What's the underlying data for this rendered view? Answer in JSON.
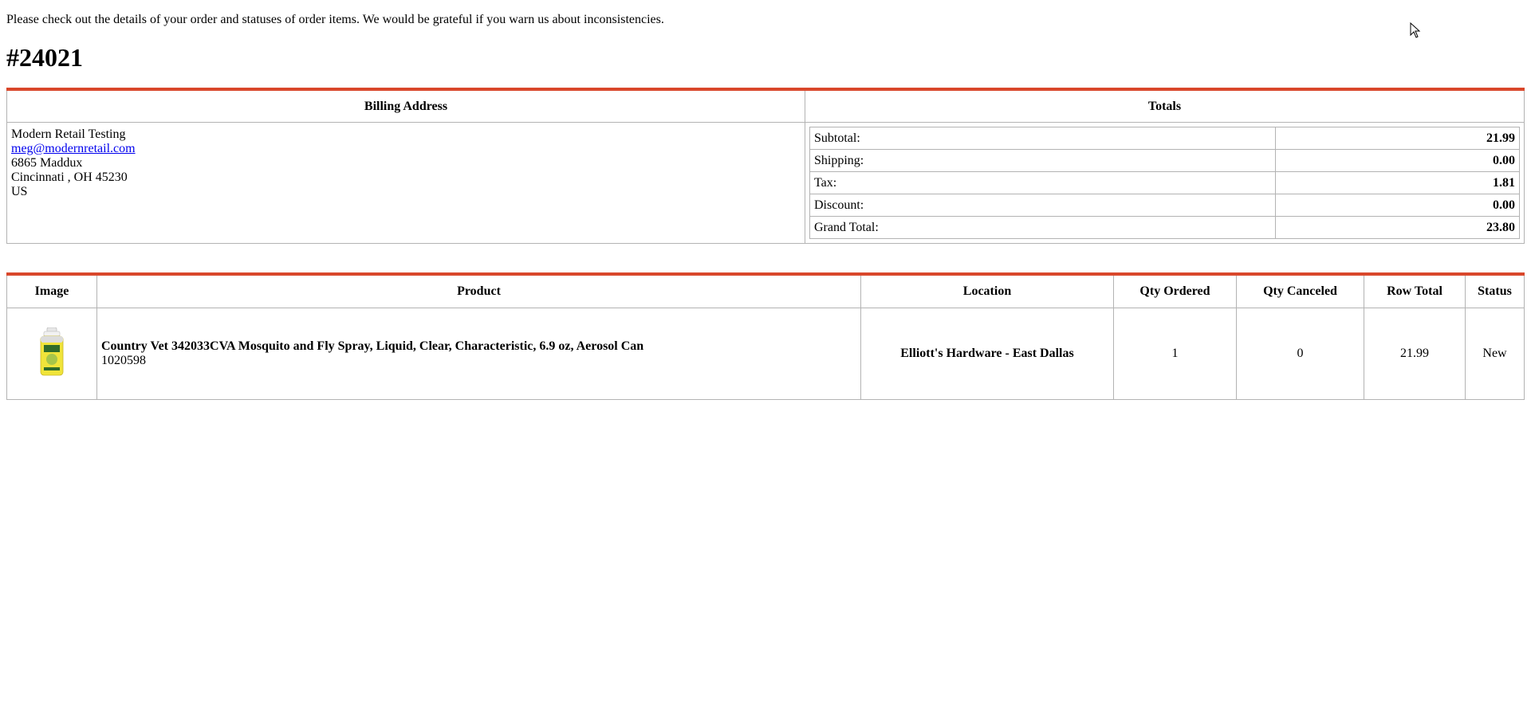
{
  "intro_text": "Please check out the details of your order and statuses of order items. We would be grateful if you warn us about inconsistencies.",
  "order_number": "#24021",
  "billing": {
    "header": "Billing Address",
    "name": "Modern Retail Testing",
    "email": "meg@modernretail.com",
    "street": "6865 Maddux",
    "city_line": "Cincinnati , OH 45230",
    "country": "US"
  },
  "totals": {
    "header": "Totals",
    "rows": [
      {
        "label": "Subtotal:",
        "value": "21.99"
      },
      {
        "label": "Shipping:",
        "value": "0.00"
      },
      {
        "label": "Tax:",
        "value": "1.81"
      },
      {
        "label": "Discount:",
        "value": "0.00"
      },
      {
        "label": "Grand Total:",
        "value": "23.80"
      }
    ]
  },
  "items": {
    "headers": {
      "image": "Image",
      "product": "Product",
      "location": "Location",
      "qty_ordered": "Qty Ordered",
      "qty_canceled": "Qty Canceled",
      "row_total": "Row Total",
      "status": "Status"
    },
    "rows": [
      {
        "image_icon": "spray-can-icon",
        "product_name": "Country Vet 342033CVA Mosquito and Fly Spray, Liquid, Clear, Characteristic, 6.9 oz, Aerosol Can",
        "sku": "1020598",
        "location": "Elliott's Hardware - East Dallas",
        "qty_ordered": "1",
        "qty_canceled": "0",
        "row_total": "21.99",
        "status": "New"
      }
    ]
  },
  "colors": {
    "accent_border": "#d9472b",
    "cell_border": "#b3b3b3",
    "link": "#0000ee"
  }
}
